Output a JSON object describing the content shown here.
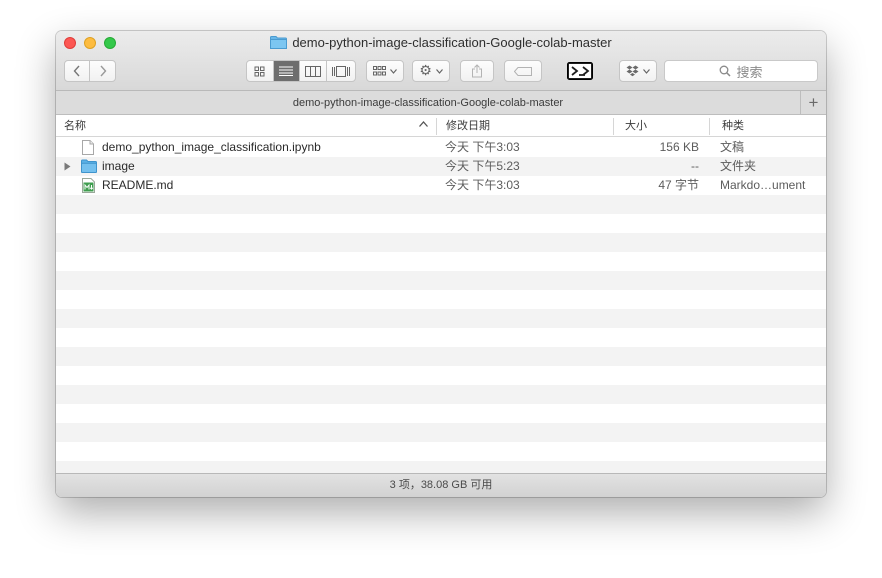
{
  "window": {
    "title": "demo-python-image-classification-Google-colab-master"
  },
  "toolbar": {
    "back_icon": "chevron-left-icon",
    "forward_icon": "chevron-right-icon",
    "view_modes": [
      "icon-view",
      "list-view",
      "column-view",
      "cover-flow-view"
    ],
    "active_view": "list-view",
    "search_placeholder": "搜索"
  },
  "pathbar": {
    "title": "demo-python-image-classification-Google-colab-master",
    "add_tab_label": "+"
  },
  "columns": {
    "name": "名称",
    "date": "修改日期",
    "size": "大小",
    "kind": "种类"
  },
  "files": [
    {
      "name": "demo_python_image_classification.ipynb",
      "date": "今天 下午3:03",
      "size": "156 KB",
      "kind": "文稿",
      "icon": "document-icon"
    },
    {
      "name": "image",
      "date": "今天 下午5:23",
      "size": "--",
      "kind": "文件夹",
      "icon": "folder-icon"
    },
    {
      "name": "README.md",
      "date": "今天 下午3:03",
      "size": "47 字节",
      "kind": "Markdo…ument",
      "icon": "markdown-file-icon"
    }
  ],
  "status": "3 项，38.08 GB 可用",
  "colors": {
    "close": "#fc5753",
    "minimize": "#fdbc40",
    "maximize": "#34c84a",
    "folder": "#5ab1e6",
    "stripe": "#f3f3f3"
  }
}
